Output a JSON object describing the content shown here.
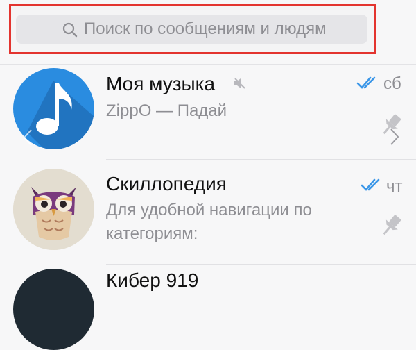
{
  "search": {
    "placeholder": "Поиск по сообщениям и людям"
  },
  "colors": {
    "highlight": "#e3342f",
    "accent_blue": "#2a8ce0",
    "check_blue": "#3a96e8",
    "secondary_text": "#8e8e93"
  },
  "chats": [
    {
      "title": "Моя музыка",
      "preview": "ZippO — Падай",
      "date": "сб",
      "muted": true,
      "pinned": true,
      "read": true,
      "avatar": "music-note-icon"
    },
    {
      "title": "Скиллопедия",
      "preview": "Для удобной навигации по категориям:",
      "date": "чт",
      "muted": false,
      "pinned": true,
      "read": true,
      "avatar": "owl-avatar"
    },
    {
      "title": "Кибер   919"
    }
  ]
}
